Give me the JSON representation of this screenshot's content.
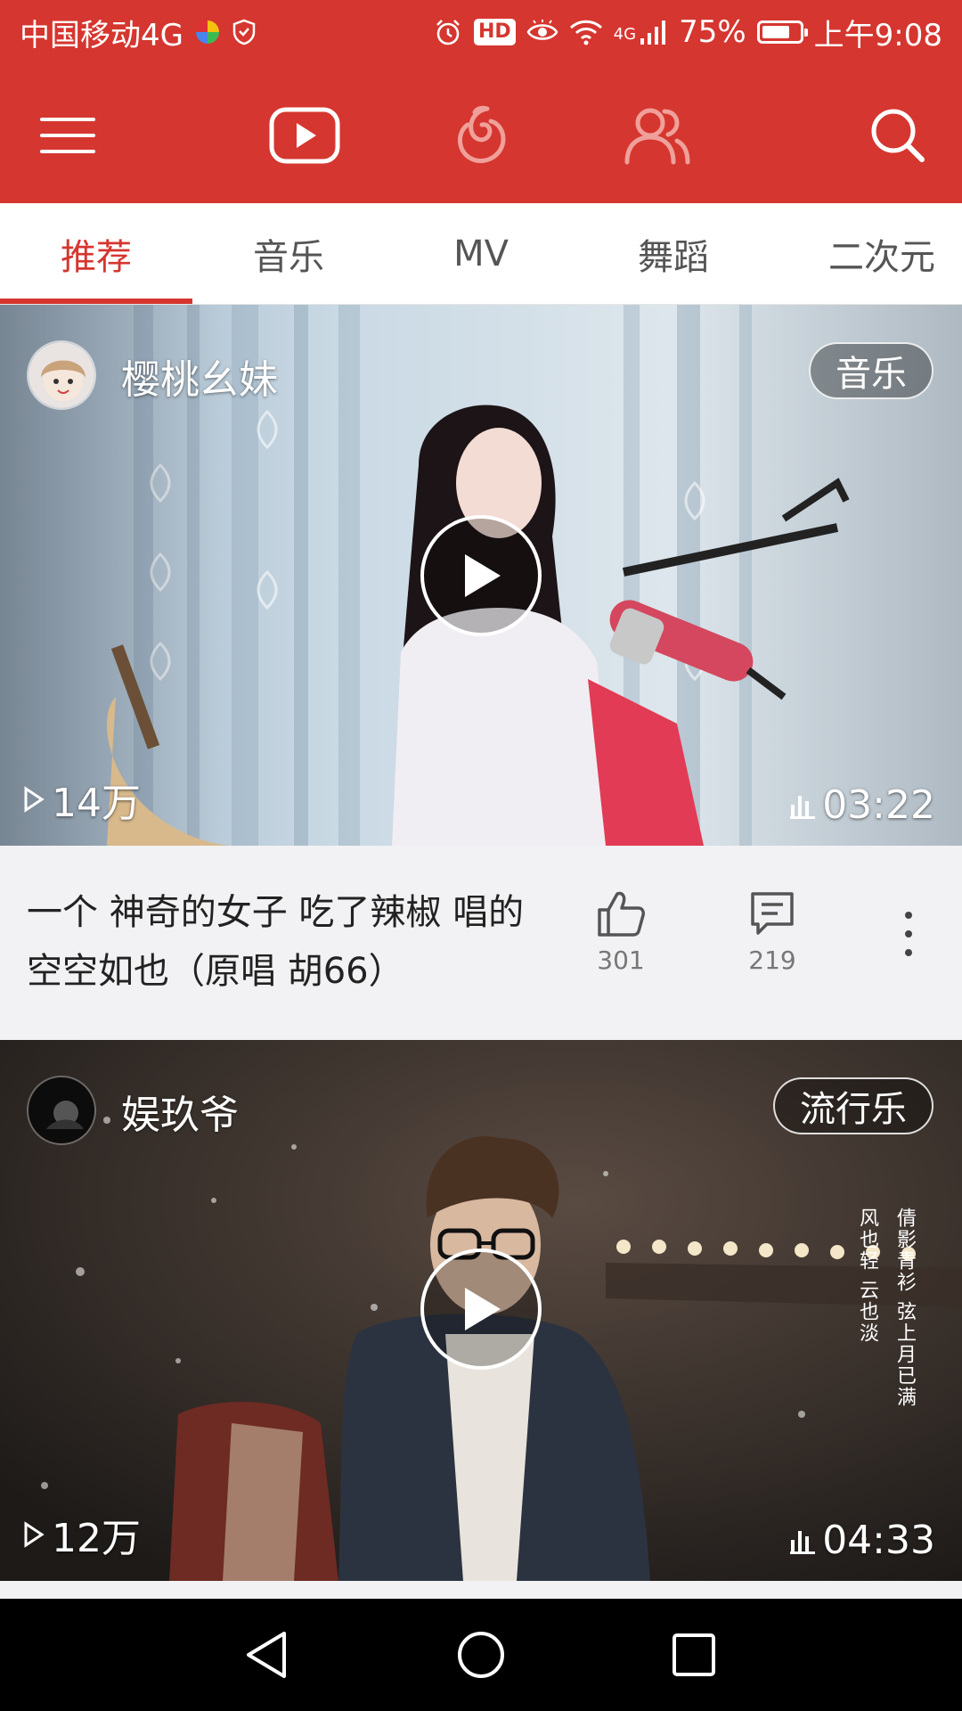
{
  "status_bar": {
    "carrier": "中国移动4G",
    "network_label": "4G",
    "battery": "75%",
    "battery_level": 0.75,
    "time": "上午9:08",
    "hd": "HD"
  },
  "header": {
    "icons": [
      "menu-icon",
      "video-icon",
      "music-logo-icon",
      "friends-icon",
      "search-icon"
    ]
  },
  "tabs": [
    {
      "label": "推荐",
      "active": true
    },
    {
      "label": "音乐",
      "active": false
    },
    {
      "label": "MV",
      "active": false
    },
    {
      "label": "舞蹈",
      "active": false
    },
    {
      "label": "二次元",
      "active": false
    }
  ],
  "videos": [
    {
      "uploader": "樱桃幺妹",
      "tag": "音乐",
      "views": "14万",
      "duration": "03:22",
      "title": "一个 神奇的女子 吃了辣椒 唱的 空空如也（原唱 胡66）",
      "likes": "301",
      "comments": "219"
    },
    {
      "uploader": "娱玖爷",
      "tag": "流行乐",
      "views": "12万",
      "duration": "04:33",
      "overlay_lines": [
        "倩影青衫 弦上月已满",
        "风也轻 云也淡"
      ]
    }
  ],
  "colors": {
    "brand_red": "#d5362f",
    "background": "#f2f2f4"
  }
}
